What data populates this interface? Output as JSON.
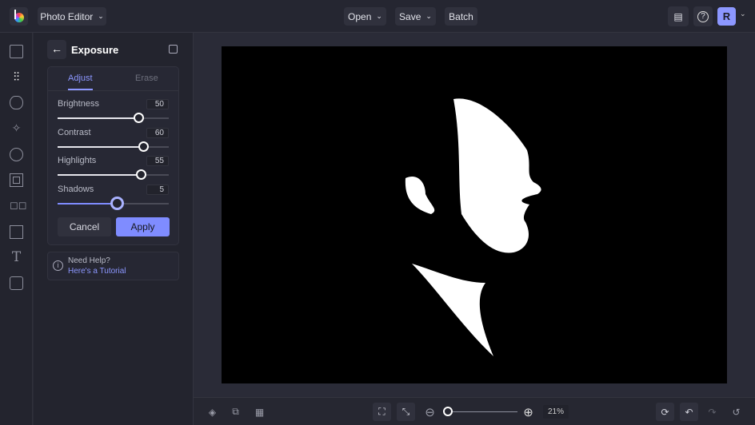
{
  "header": {
    "app_menu": "Photo Editor",
    "open": "Open",
    "save": "Save",
    "batch": "Batch",
    "avatar": "R"
  },
  "panel": {
    "title": "Exposure",
    "tabs": [
      {
        "label": "Adjust",
        "active": true
      },
      {
        "label": "Erase",
        "active": false
      }
    ],
    "sliders": [
      {
        "label": "Brightness",
        "value": "50",
        "fraction": 0.73
      },
      {
        "label": "Contrast",
        "value": "60",
        "fraction": 0.77
      },
      {
        "label": "Highlights",
        "value": "55",
        "fraction": 0.75
      },
      {
        "label": "Shadows",
        "value": "5",
        "fraction": 0.52
      }
    ],
    "cancel": "Cancel",
    "apply": "Apply",
    "help": {
      "title": "Need Help?",
      "link": "Here's a Tutorial"
    }
  },
  "footer": {
    "zoom": "21%",
    "zoom_fraction": 0.05
  },
  "colors": {
    "accent": "#7f8cff"
  }
}
